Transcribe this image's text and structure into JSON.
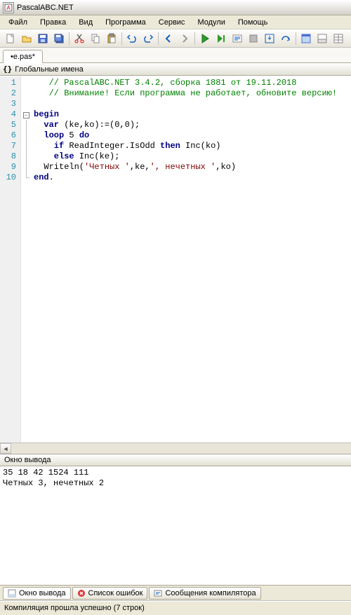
{
  "window": {
    "title": "PascalABC.NET"
  },
  "menu": {
    "file": "Файл",
    "edit": "Правка",
    "view": "Вид",
    "program": "Программа",
    "service": "Сервис",
    "modules": "Модули",
    "help": "Помощь"
  },
  "tabs": {
    "active": "•e.pas*"
  },
  "nav": {
    "label": "Глобальные имена"
  },
  "code": {
    "lines": [
      "1",
      "2",
      "3",
      "4",
      "5",
      "6",
      "7",
      "8",
      "9",
      "10"
    ],
    "l1_comment": "   // PascalABC.NET 3.4.2, сборка 1881 от 19.11.2018",
    "l2_comment": "   // Внимание! Если программа не работает, обновите версию!",
    "l4_begin": "begin",
    "l5_var": "  var",
    "l5_rest": " (ke,ko):=(0,0);",
    "l6_loop": "  loop",
    "l6_n": " 5",
    "l6_do": " do",
    "l7_if": "    if",
    "l7_cond": " ReadInteger.IsOdd",
    "l7_then": " then",
    "l7_act": " Inc(ko)",
    "l8_else": "    else",
    "l8_act": " Inc(ke);",
    "l9_call": "  Writeln(",
    "l9_s1": "'Четных '",
    "l9_m1": ",ke,",
    "l9_s2": "', нечетных '",
    "l9_m2": ",ko)",
    "l10_end": "end",
    "l10_dot": "."
  },
  "output_panel": {
    "title": "Окно вывода",
    "line1": "35 18 42 1524 111",
    "line2": "Четных 3, нечетных 2"
  },
  "bottom_tabs": {
    "output": "Окно вывода",
    "errors": "Список ошибок",
    "compiler": "Сообщения компилятора"
  },
  "status": {
    "text": "Компиляция прошла успешно (7 строк)"
  }
}
